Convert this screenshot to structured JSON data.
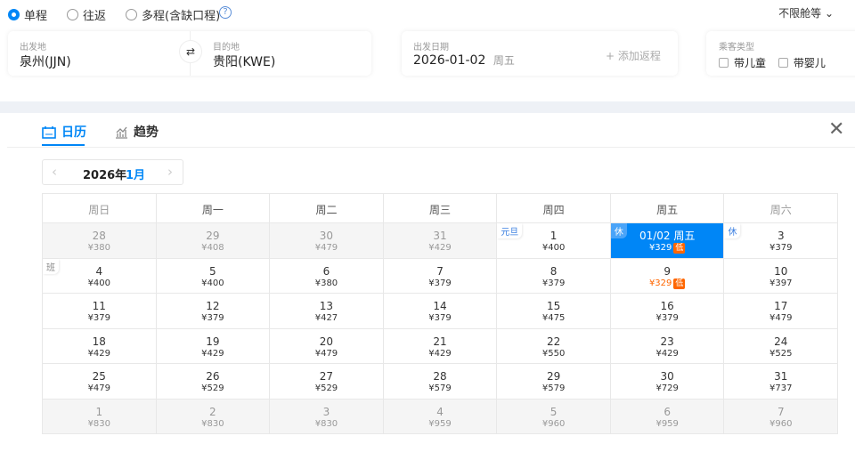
{
  "trip_types": [
    {
      "label": "单程",
      "selected": true
    },
    {
      "label": "往返",
      "selected": false
    },
    {
      "label": "多程(含缺口程)",
      "selected": false
    }
  ],
  "help_icon": "?",
  "cabin": "不限舱等 ⌄",
  "origin": {
    "label": "出发地",
    "value": "泉州(JJN)"
  },
  "destination": {
    "label": "目的地",
    "value": "贵阳(KWE)"
  },
  "date": {
    "label": "出发日期",
    "value": "2026-01-02",
    "weekday": "周五",
    "add_return": "+ 添加返程"
  },
  "passenger": {
    "label": "乘客类型",
    "child": "带儿童",
    "infant": "带婴儿"
  },
  "tabs": {
    "calendar": "日历",
    "trend": "趋势"
  },
  "month_nav": {
    "year": "2026年",
    "month": "1月"
  },
  "weekdays": [
    "周日",
    "周一",
    "周二",
    "周三",
    "周四",
    "周五",
    "周六"
  ],
  "colors": {
    "accent": "#0086f6",
    "low": "#ff6600"
  },
  "weeks": [
    [
      {
        "d": "28",
        "p": "¥380",
        "dim": true
      },
      {
        "d": "29",
        "p": "¥408",
        "dim": true
      },
      {
        "d": "30",
        "p": "¥479",
        "dim": true
      },
      {
        "d": "31",
        "p": "¥429",
        "dim": true
      },
      {
        "d": "1",
        "p": "¥400",
        "tag": "元旦"
      },
      {
        "d": "01/02 周五",
        "p": "¥329",
        "low": "低",
        "sel": true,
        "tag": "休"
      },
      {
        "d": "3",
        "p": "¥379",
        "tag": "休"
      }
    ],
    [
      {
        "d": "4",
        "p": "¥400",
        "tag": "班",
        "ban": true
      },
      {
        "d": "5",
        "p": "¥400"
      },
      {
        "d": "6",
        "p": "¥380"
      },
      {
        "d": "7",
        "p": "¥379"
      },
      {
        "d": "8",
        "p": "¥379"
      },
      {
        "d": "9",
        "p": "¥329",
        "low": "低",
        "orange": true
      },
      {
        "d": "10",
        "p": "¥397"
      }
    ],
    [
      {
        "d": "11",
        "p": "¥379"
      },
      {
        "d": "12",
        "p": "¥379"
      },
      {
        "d": "13",
        "p": "¥427"
      },
      {
        "d": "14",
        "p": "¥379"
      },
      {
        "d": "15",
        "p": "¥475"
      },
      {
        "d": "16",
        "p": "¥379"
      },
      {
        "d": "17",
        "p": "¥479"
      }
    ],
    [
      {
        "d": "18",
        "p": "¥429"
      },
      {
        "d": "19",
        "p": "¥429"
      },
      {
        "d": "20",
        "p": "¥479"
      },
      {
        "d": "21",
        "p": "¥429"
      },
      {
        "d": "22",
        "p": "¥550"
      },
      {
        "d": "23",
        "p": "¥429"
      },
      {
        "d": "24",
        "p": "¥525"
      }
    ],
    [
      {
        "d": "25",
        "p": "¥479"
      },
      {
        "d": "26",
        "p": "¥529"
      },
      {
        "d": "27",
        "p": "¥529"
      },
      {
        "d": "28",
        "p": "¥579"
      },
      {
        "d": "29",
        "p": "¥579"
      },
      {
        "d": "30",
        "p": "¥729"
      },
      {
        "d": "31",
        "p": "¥737"
      }
    ],
    [
      {
        "d": "1",
        "p": "¥830",
        "dim": true
      },
      {
        "d": "2",
        "p": "¥830",
        "dim": true
      },
      {
        "d": "3",
        "p": "¥830",
        "dim": true
      },
      {
        "d": "4",
        "p": "¥959",
        "dim": true
      },
      {
        "d": "5",
        "p": "¥960",
        "dim": true
      },
      {
        "d": "6",
        "p": "¥959",
        "dim": true
      },
      {
        "d": "7",
        "p": "¥960",
        "dim": true
      }
    ]
  ]
}
